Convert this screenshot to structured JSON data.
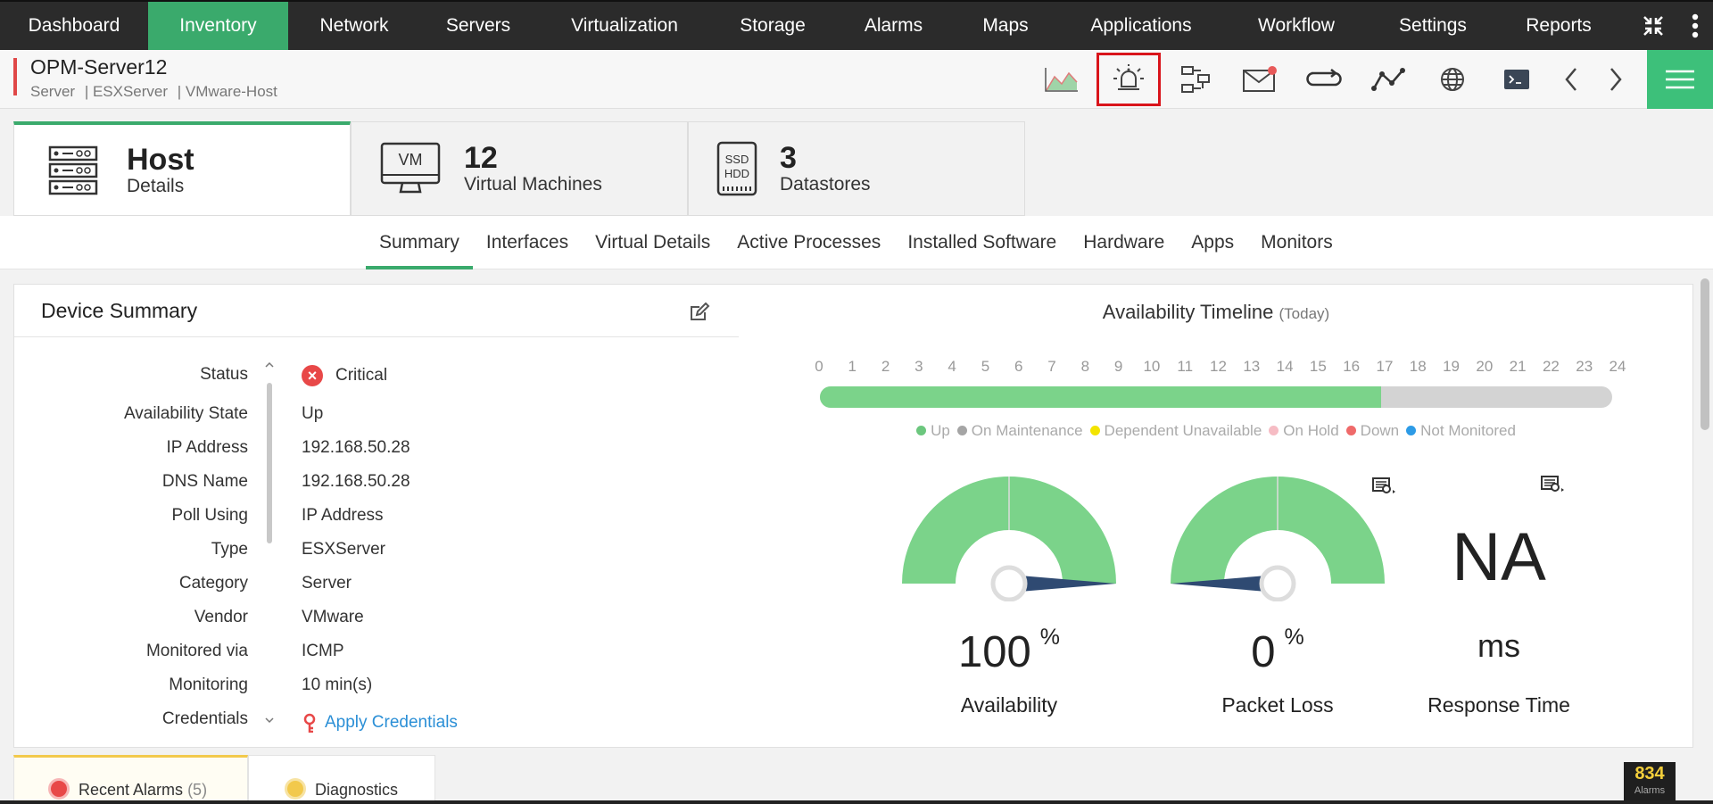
{
  "nav": {
    "items": [
      {
        "label": "Dashboard",
        "w": 0
      },
      {
        "label": "Inventory"
      },
      {
        "label": "Network"
      },
      {
        "label": "Servers"
      },
      {
        "label": "Virtualization"
      },
      {
        "label": "Storage"
      },
      {
        "label": "Alarms"
      },
      {
        "label": "Maps"
      },
      {
        "label": "Applications"
      },
      {
        "label": "Workflow"
      },
      {
        "label": "Settings"
      },
      {
        "label": "Reports"
      }
    ],
    "active": "Inventory"
  },
  "header": {
    "title": "OPM-Server12",
    "crumbs": [
      "Server",
      "| ESXServer",
      "| VMware-Host"
    ]
  },
  "cards": [
    {
      "big": "Host",
      "sub": "Details",
      "icon": "server-rack-icon"
    },
    {
      "big": "12",
      "sub": "Virtual Machines",
      "icon": "vm-monitor-icon"
    },
    {
      "big": "3",
      "sub": "Datastores",
      "icon": "ssd-hdd-icon"
    }
  ],
  "tabs": [
    "Summary",
    "Interfaces",
    "Virtual Details",
    "Active Processes",
    "Installed Software",
    "Hardware",
    "Apps",
    "Monitors"
  ],
  "device_summary": {
    "title": "Device Summary",
    "rows": [
      {
        "label": "Status",
        "value": "Critical"
      },
      {
        "label": "Availability State",
        "value": "Up"
      },
      {
        "label": "IP Address",
        "value": "192.168.50.28"
      },
      {
        "label": "DNS Name",
        "value": "192.168.50.28"
      },
      {
        "label": "Poll Using",
        "value": "IP Address"
      },
      {
        "label": "Type",
        "value": "ESXServer"
      },
      {
        "label": "Category",
        "value": "Server"
      },
      {
        "label": "Vendor",
        "value": "VMware"
      },
      {
        "label": "Monitored via",
        "value": "ICMP"
      },
      {
        "label": "Monitoring",
        "value": "10 min(s)"
      },
      {
        "label": "Credentials",
        "value": "Apply Credentials"
      }
    ]
  },
  "availability": {
    "title": "Availability Timeline",
    "period": "(Today)",
    "hours": [
      "0",
      "1",
      "2",
      "3",
      "4",
      "5",
      "6",
      "7",
      "8",
      "9",
      "10",
      "11",
      "12",
      "13",
      "14",
      "15",
      "16",
      "17",
      "18",
      "19",
      "20",
      "21",
      "22",
      "23",
      "24"
    ],
    "up_until_hour": 17,
    "legend": [
      {
        "label": "Up",
        "color": "#6cc77e"
      },
      {
        "label": "On Maintenance",
        "color": "#a5a5a5"
      },
      {
        "label": "Dependent Unavailable",
        "color": "#f3e400"
      },
      {
        "label": "On Hold",
        "color": "#f6bcc4"
      },
      {
        "label": "Down",
        "color": "#ef6a6a"
      },
      {
        "label": "Not Monitored",
        "color": "#2d9be6"
      }
    ],
    "gauges": [
      {
        "value": "100",
        "unit": "%",
        "label": "Availability",
        "level": 1.0
      },
      {
        "value": "0",
        "unit": "%",
        "label": "Packet Loss",
        "level": 0.0
      }
    ],
    "response": {
      "value": "NA",
      "unit": "ms",
      "label": "Response Time"
    }
  },
  "bottom_tabs": {
    "recent_alarms": "Recent Alarms",
    "recent_alarms_count": "(5)",
    "diagnostics": "Diagnostics"
  },
  "alarm_badge": {
    "count": "834",
    "label": "Alarms"
  },
  "colors": {
    "accent": "#3aaa6c",
    "nav_bg": "#2b2b2b",
    "critical": "#e84848",
    "gauge": "#7bd38a",
    "needle": "#2f4a72"
  }
}
